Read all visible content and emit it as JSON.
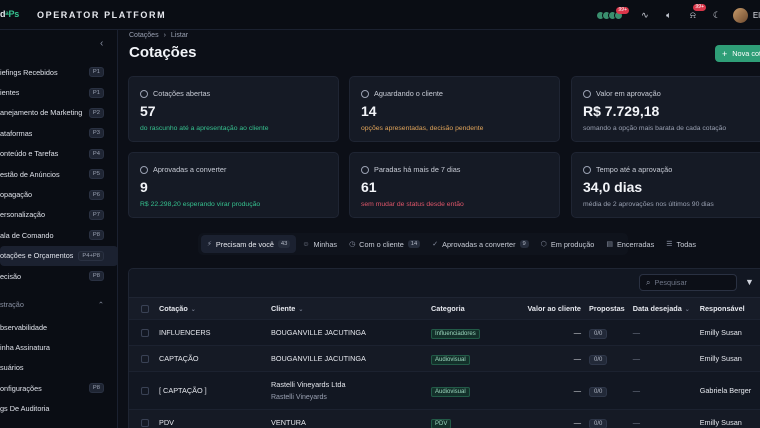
{
  "topbar": {
    "logo_left": "d",
    "logo_accent": "ᵃPs",
    "platform": "OPERATOR PLATFORM",
    "avatars_badge": "99+",
    "notif_badge": "99+",
    "user_initials": "El"
  },
  "sidebar": {
    "collapse_icon": "chevron-left-icon",
    "items": [
      {
        "label": "iefings Recebidos",
        "kbd": "P1"
      },
      {
        "label": "ientes",
        "kbd": "P1"
      },
      {
        "label": "anejamento de Marketing",
        "kbd": "P2"
      },
      {
        "label": "ataformas",
        "kbd": "P3"
      },
      {
        "label": "onteúdo e Tarefas",
        "kbd": "P4"
      },
      {
        "label": "estão de Anúncios",
        "kbd": "P5"
      },
      {
        "label": "opagação",
        "kbd": "P6"
      },
      {
        "label": "ersonalização",
        "kbd": "P7"
      },
      {
        "label": "ala de Comando",
        "kbd": "P8"
      },
      {
        "label": "otações e Orçamentos",
        "kbd": "P4+P8"
      },
      {
        "label": "ecisão",
        "kbd": "P8"
      }
    ],
    "section": "stração",
    "admin_items": [
      {
        "label": "bservabilidade",
        "kbd": ""
      },
      {
        "label": "inha Assinatura",
        "kbd": ""
      },
      {
        "label": "suários",
        "kbd": ""
      },
      {
        "label": "onfigurações",
        "kbd": "P8"
      },
      {
        "label": "gs De Auditoria",
        "kbd": ""
      }
    ]
  },
  "breadcrumb": {
    "root": "Cotações",
    "current": "Listar",
    "sep": "›"
  },
  "page": {
    "title": "Cotações",
    "new_button": "Nova cot"
  },
  "cards": [
    {
      "label": "Cotações abertas",
      "value": "57",
      "sub": "do rascunho até a apresentação ao cliente",
      "sub_color": "#36c28f"
    },
    {
      "label": "Aguardando o cliente",
      "value": "14",
      "sub": "opções apresentadas, decisão pendente",
      "sub_color": "#e0a45a"
    },
    {
      "label": "Valor em aprovação",
      "value": "R$ 7.729,18",
      "sub": "somando a opção mais barata de cada cotação",
      "sub_color": "#9aa1b2"
    },
    {
      "label": "Aprovadas a converter",
      "value": "9",
      "sub": "R$ 22.298,20 esperando virar produção",
      "sub_color": "#36c28f"
    },
    {
      "label": "Paradas há mais de 7 dias",
      "value": "61",
      "sub": "sem mudar de status desde então",
      "sub_color": "#e0566a"
    },
    {
      "label": "Tempo até a aprovação",
      "value": "34,0 dias",
      "sub": "média de 2 aprovações nos últimos 90 dias",
      "sub_color": "#9aa1b2"
    }
  ],
  "filters": [
    {
      "label": "Precisam de você",
      "count": "43",
      "icon": "⚡"
    },
    {
      "label": "Minhas",
      "count": "",
      "icon": "☺"
    },
    {
      "label": "Com o cliente",
      "count": "14",
      "icon": "◷"
    },
    {
      "label": "Aprovadas a converter",
      "count": "9",
      "icon": "✓"
    },
    {
      "label": "Em produção",
      "count": "",
      "icon": "⬡"
    },
    {
      "label": "Encerradas",
      "count": "",
      "icon": "▤"
    },
    {
      "label": "Todas",
      "count": "",
      "icon": "☰"
    }
  ],
  "search": {
    "placeholder": "Pesquisar"
  },
  "table": {
    "headers": {
      "cotacao": "Cotação",
      "cliente": "Cliente",
      "categoria": "Categoria",
      "valor": "Valor ao cliente",
      "propostas": "Propostas",
      "data": "Data desejada",
      "responsavel": "Responsável"
    },
    "rows": [
      {
        "cotacao": "INFLUENCERS",
        "cliente": "BOUGANVILLE JACUTINGA",
        "cliente_sub": "",
        "categoria": "Influenciadores",
        "valor": "—",
        "propostas": "0/0",
        "data": "—",
        "responsavel": "Emilly Susan"
      },
      {
        "cotacao": "CAPTAÇÃO",
        "cliente": "BOUGANVILLE JACUTINGA",
        "cliente_sub": "",
        "categoria": "Audiovisual",
        "valor": "—",
        "propostas": "0/0",
        "data": "—",
        "responsavel": "Emilly Susan"
      },
      {
        "cotacao": "[ CAPTAÇÃO ]",
        "cliente": "Rastelli Vineyards Ltda",
        "cliente_sub": "Rastelli Vineyards",
        "categoria": "Audiovisual",
        "valor": "—",
        "propostas": "0/0",
        "data": "—",
        "responsavel": "Gabriela Berger"
      },
      {
        "cotacao": "PDV",
        "cliente": "VENTURA",
        "cliente_sub": "",
        "categoria": "PDV",
        "valor": "—",
        "propostas": "0/0",
        "data": "—",
        "responsavel": "Emilly Susan"
      }
    ]
  }
}
